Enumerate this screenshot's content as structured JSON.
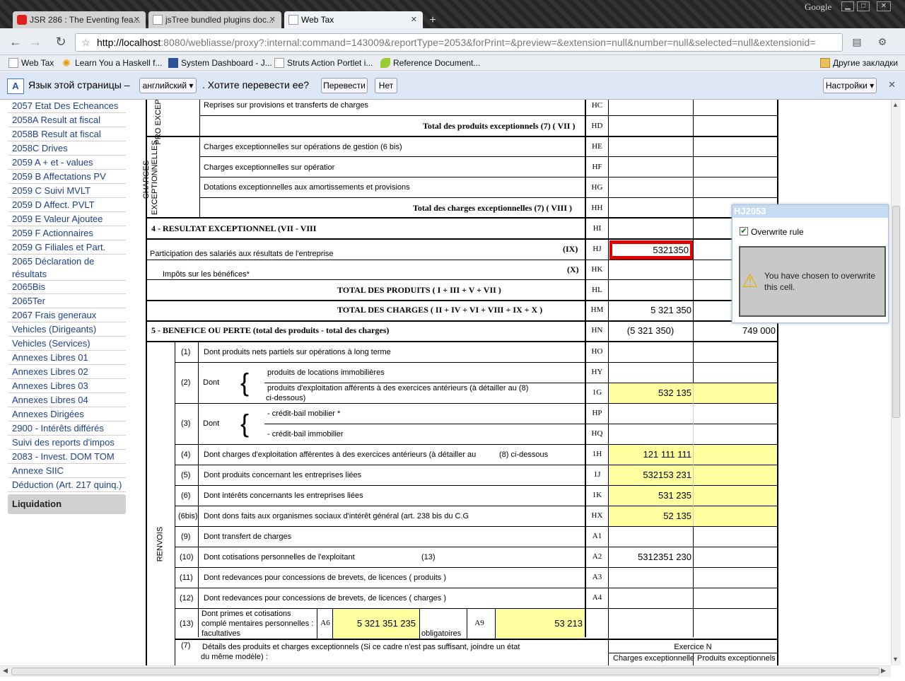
{
  "browser": {
    "google_label": "Google",
    "tabs": [
      {
        "label": "JSR 286 : The Eventing fea...",
        "icon": "oracle-icon"
      },
      {
        "label": "jsTree bundled plugins doc...",
        "icon": "page-icon"
      },
      {
        "label": "Web Tax",
        "icon": "page-icon"
      }
    ],
    "url_host": "http://localhost",
    "url_rest": ":8080/webliasse/proxy?:internal:command=143009&reportType=2053&forPrint=&preview=&extension=null&number=null&selected=null&extensionid=",
    "bookmarks": [
      "Web Tax",
      "Learn You a Haskell f...",
      "System Dashboard - J...",
      "Struts Action Portlet i...",
      "Reference Document..."
    ],
    "other_bookmarks": "Другие закладки"
  },
  "translate": {
    "prompt": "Язык этой страницы –",
    "language": "английский",
    "question": ". Хотите перевести ее?",
    "translate_btn": "Перевести",
    "no_btn": "Нет",
    "settings_btn": "Настройки"
  },
  "sidebar": {
    "items": [
      "2057 Etat Des Echeances",
      "2058A Result at fiscal",
      "2058B Result at fiscal",
      "2058C Drives",
      "2059 A + et - values",
      "2059 B Affectations PV",
      "2059 C Suivi MVLT",
      "2059 D Affect. PVLT",
      "2059 E Valeur Ajoutee",
      "2059 F Actionnaires",
      "2059 G Filiales et Part.",
      "2065 Déclaration de résultats",
      "2065Bis",
      "2065Ter",
      "2067 Frais generaux",
      "Vehicles (Dirigeants)",
      "Vehicles (Services)",
      "Annexes Libres 01",
      "Annexes Libres 02",
      "Annexes Libres 03",
      "Annexes Libres 04",
      "Annexes Dirigées",
      "2900 - Intérêts différés",
      "Suivi des reports d'impos",
      "2083 - Invest. DOM TOM",
      "Annexe SIIC",
      "Déduction (Art. 217 quinq.)"
    ],
    "active": "Liquidation"
  },
  "form": {
    "side_labels": {
      "prod": "PRO EXCEPT",
      "charges": "CHARGES EXCEPTIONNELLES",
      "renvois": "RENVOIS"
    },
    "rows": [
      {
        "label": "Reprises sur provisions et transferts de charges",
        "code": "HC",
        "c1": "",
        "c2": ""
      },
      {
        "label": "Total des produits exceptionnels (7) ( VII )",
        "code": "HD",
        "c1": "",
        "c2": ""
      },
      {
        "label": "Charges exceptionnelles sur opérations de gestion (6 bis)",
        "code": "HE",
        "c1": "",
        "c2": ""
      },
      {
        "label": "Charges exceptionnelles sur opératior",
        "code": "HF",
        "c1": "",
        "c2": ""
      },
      {
        "label": "Dotations exceptionnelles aux amortissements et provisions",
        "code": "HG",
        "c1": "",
        "c2": ""
      },
      {
        "label": "Total des charges exceptionnelles (7) ( VIII )",
        "code": "HH",
        "c1": "",
        "c2": ""
      },
      {
        "label": "4 - RESULTAT EXCEPTIONNEL (VII - VIII",
        "code": "HI",
        "c1": "",
        "c2": ""
      },
      {
        "label": "Participation des salariés aux résultats de l'entreprise",
        "num": "(IX)",
        "code": "HJ",
        "c1": "5321350",
        "c2": ""
      },
      {
        "label": "Impôts sur les bénéfices*",
        "num": "(X)",
        "code": "HK",
        "c1": "",
        "c2": ""
      },
      {
        "label": "TOTAL DES PRODUITS ( I + III + V + VII )",
        "code": "HL",
        "c1": "",
        "c2": ""
      },
      {
        "label": "TOTAL DES CHARGES ( II + IV + VI + VIII + IX + X )",
        "code": "HM",
        "c1": "5 321 350",
        "c2": ""
      },
      {
        "label": "5 - BENEFICE OU PERTE (total des produits - total des charges)",
        "code": "HN",
        "c1": "(5 321 350)",
        "c2": "749 000"
      }
    ],
    "renvois": [
      {
        "num": "(1)",
        "label": "Dont produits nets partiels sur opérations à long terme",
        "code": "HO",
        "c1": ""
      },
      {
        "num": "(2)",
        "dont": "Dont",
        "sub": [
          "produits de locations immobilières",
          "produits d'exploitation afférents à des exercices antérieurs (à détailler au (8)",
          "ci-dessous)"
        ],
        "codes": [
          "HY",
          "1G"
        ],
        "vals": [
          "",
          "532 135"
        ]
      },
      {
        "num": "(3)",
        "dont": "Dont",
        "sub": [
          "- crédit-bail mobilier *",
          "- crédit-bail immobilier"
        ],
        "codes": [
          "HP",
          "HQ"
        ],
        "vals": [
          "",
          ""
        ]
      },
      {
        "num": "(4)",
        "label": "Dont charges d'exploitation afférentes à des exercices antérieurs (à détailler au",
        "extra": "(8) ci-dessous",
        "code": "1H",
        "c1": "121 111 111"
      },
      {
        "num": "(5)",
        "label": "Dont produits concernant les entreprises liées",
        "code": "1J",
        "c1": "532153 231"
      },
      {
        "num": "(6)",
        "label": "Dont intérêts concernants les entreprises liées",
        "code": "1K",
        "c1": "531 235"
      },
      {
        "num": "(6bis)",
        "label": "Dont dons faits aux organismes sociaux d'intérêt général (art. 238 bis du C.G",
        "code": "HX",
        "c1": "52 135"
      },
      {
        "num": "(9)",
        "label": "Dont transfert de charges",
        "code": "A1",
        "c1": ""
      },
      {
        "num": "(10)",
        "label": "Dont cotisations personnelles de l'exploitant",
        "extra": "(13)",
        "code": "A2",
        "c1": "5312351 230"
      },
      {
        "num": "(11)",
        "label": "Dont redevances pour concessions de brevets, de licences ( produits )",
        "code": "A3",
        "c1": ""
      },
      {
        "num": "(12)",
        "label": "Dont redevances pour concessions de brevets, de licences ( charges )",
        "code": "A4",
        "c1": ""
      }
    ],
    "row13": {
      "num": "(13)",
      "label1": "Dont primes et cotisations",
      "label2": "complé mentaires personnelles :",
      "label3": "facultatives",
      "code_a": "A6",
      "val_a": "5 321 351 235",
      "oblig": "obligatoires",
      "code_b": "A9",
      "val_b": "53 213"
    },
    "row7": {
      "num": "(7)",
      "label1": "Détails des produits et charges exceptionnels (Si ce cadre n'est pas suffisant, joindre un état",
      "label2": "du même modèle) :",
      "exercice": "Exercice N",
      "col1": "Charges exceptionnelle",
      "col2": "Produits exceptionnels"
    }
  },
  "popup": {
    "title": "HJ2053",
    "checkbox_label": "Overwrite rule",
    "checked": true,
    "message": "You have chosen to overwrite this cell."
  }
}
